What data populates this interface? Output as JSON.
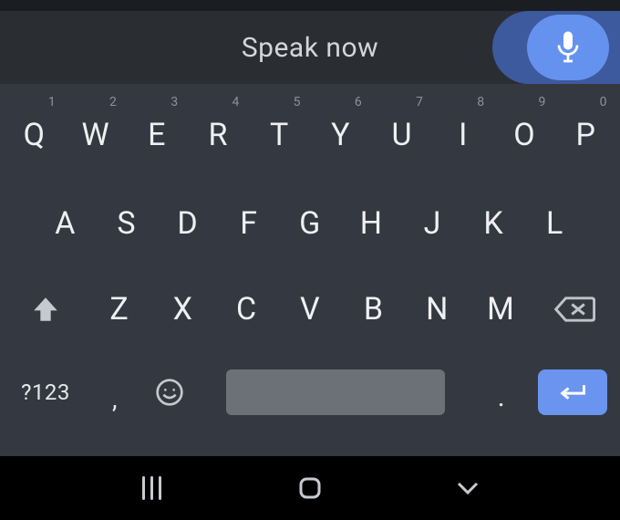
{
  "header": {
    "title": "Speak now"
  },
  "keyboard": {
    "row1": [
      {
        "label": "Q",
        "sup": "1"
      },
      {
        "label": "W",
        "sup": "2"
      },
      {
        "label": "E",
        "sup": "3"
      },
      {
        "label": "R",
        "sup": "4"
      },
      {
        "label": "T",
        "sup": "5"
      },
      {
        "label": "Y",
        "sup": "6"
      },
      {
        "label": "U",
        "sup": "7"
      },
      {
        "label": "I",
        "sup": "8"
      },
      {
        "label": "O",
        "sup": "9"
      },
      {
        "label": "P",
        "sup": "0"
      }
    ],
    "row2": [
      {
        "label": "A"
      },
      {
        "label": "S"
      },
      {
        "label": "D"
      },
      {
        "label": "F"
      },
      {
        "label": "G"
      },
      {
        "label": "H"
      },
      {
        "label": "J"
      },
      {
        "label": "K"
      },
      {
        "label": "L"
      }
    ],
    "row3": [
      {
        "label": "Z"
      },
      {
        "label": "X"
      },
      {
        "label": "C"
      },
      {
        "label": "V"
      },
      {
        "label": "B"
      },
      {
        "label": "N"
      },
      {
        "label": "M"
      }
    ],
    "symbols_label": "?123",
    "comma": ",",
    "period": "."
  },
  "icons": {
    "mic": "microphone-icon",
    "shift": "shift-icon",
    "backspace": "backspace-icon",
    "emoji": "emoji-icon",
    "enter": "enter-icon",
    "nav_recents": "recents-icon",
    "nav_home": "home-icon",
    "nav_back": "back-icon"
  },
  "colors": {
    "accent": "#6a94ef",
    "keyboard_bg": "#343840",
    "header_bg": "#2a2e33"
  }
}
